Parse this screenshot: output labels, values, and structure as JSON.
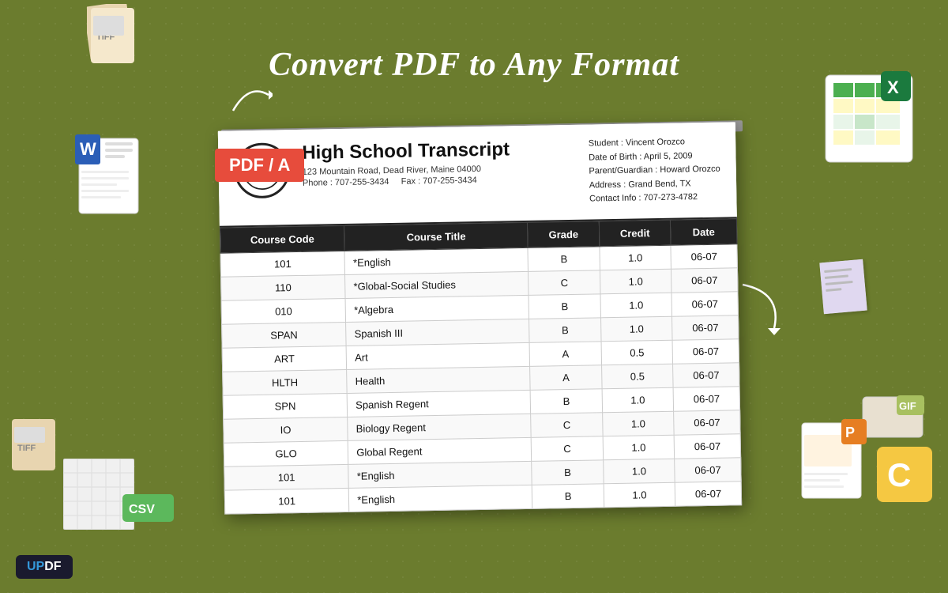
{
  "app": {
    "title": "UPDF",
    "headline": "Convert PDF to Any Format"
  },
  "badge": {
    "label": "PDF / A"
  },
  "document": {
    "school_logo": "🎓",
    "title": "High School Transcript",
    "address": "123 Mountain Road, Dead River, Maine 04000",
    "phone": "Phone : 707-255-3434",
    "fax": "Fax : 707-255-3434",
    "student": {
      "name_label": "Student : Vincent Orozco",
      "dob_label": "Date of Birth : April 5, 2009",
      "guardian_label": "Parent/Guardian : Howard Orozco",
      "address_label": "Address : Grand Bend, TX",
      "contact_label": "Contact Info : 707-273-4782"
    },
    "table": {
      "headers": [
        "Course Code",
        "Course Title",
        "Grade",
        "Credit",
        "Date"
      ],
      "rows": [
        [
          "101",
          "*English",
          "B",
          "1.0",
          "06-07"
        ],
        [
          "110",
          "*Global-Social Studies",
          "C",
          "1.0",
          "06-07"
        ],
        [
          "010",
          "*Algebra",
          "B",
          "1.0",
          "06-07"
        ],
        [
          "SPAN",
          "Spanish III",
          "B",
          "1.0",
          "06-07"
        ],
        [
          "ART",
          "Art",
          "A",
          "0.5",
          "06-07"
        ],
        [
          "HLTH",
          "Health",
          "A",
          "0.5",
          "06-07"
        ],
        [
          "SPN",
          "Spanish Regent",
          "B",
          "1.0",
          "06-07"
        ],
        [
          "IO",
          "Biology Regent",
          "C",
          "1.0",
          "06-07"
        ],
        [
          "GLO",
          "Global Regent",
          "C",
          "1.0",
          "06-07"
        ],
        [
          "101",
          "*English",
          "B",
          "1.0",
          "06-07"
        ],
        [
          "101",
          "*English",
          "B",
          "1.0",
          "06-07"
        ]
      ]
    }
  },
  "updf": {
    "label_up": "UP",
    "label_df": "DF"
  }
}
